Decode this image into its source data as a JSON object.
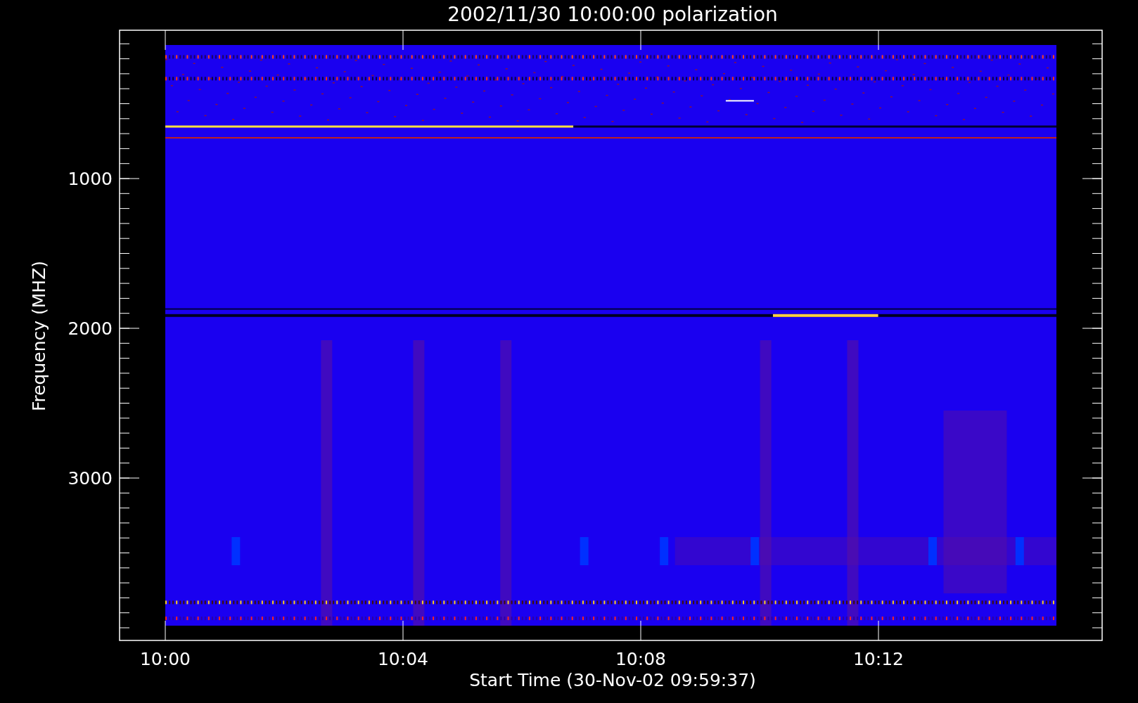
{
  "title": "2002/11/30 10:00:00 polarization",
  "y_axis": {
    "label": "Frequency (MHZ)",
    "ticks": [
      "1000",
      "2000",
      "3000"
    ]
  },
  "x_axis": {
    "label": "Start Time (30-Nov-02 09:59:37)",
    "ticks": [
      "10:00",
      "10:04",
      "10:08",
      "10:12"
    ]
  }
}
